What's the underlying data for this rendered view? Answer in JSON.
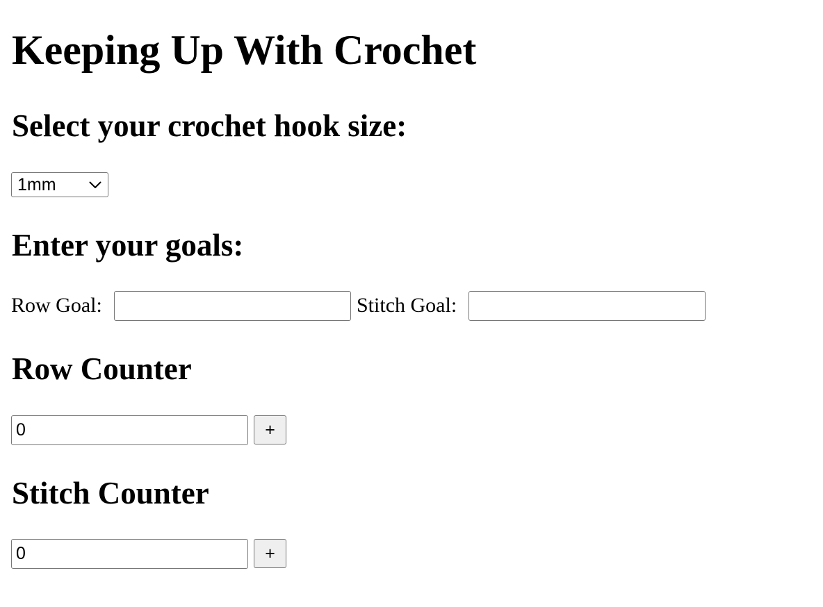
{
  "page": {
    "title": "Keeping Up With Crochet"
  },
  "hook_section": {
    "heading": "Select your crochet hook size:",
    "select_value": "1mm"
  },
  "goals_section": {
    "heading": "Enter your goals:",
    "row_goal_label": "Row Goal:",
    "row_goal_value": "",
    "stitch_goal_label": "Stitch Goal:",
    "stitch_goal_value": ""
  },
  "row_counter": {
    "heading": "Row Counter",
    "value": "0",
    "increment_label": "+"
  },
  "stitch_counter": {
    "heading": "Stitch Counter",
    "value": "0",
    "increment_label": "+"
  },
  "icons": {
    "select_arrow": "chevron-down-icon"
  }
}
